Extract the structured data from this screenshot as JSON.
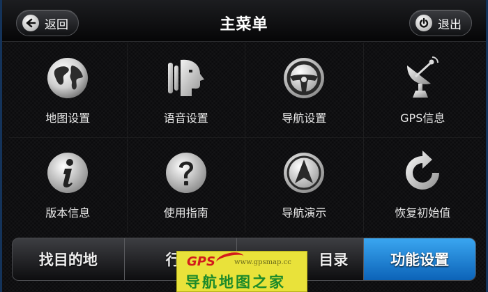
{
  "header": {
    "back_label": "返回",
    "title": "主菜单",
    "exit_label": "退出"
  },
  "menu": {
    "items": [
      {
        "label": "地图设置",
        "icon": "globe-icon"
      },
      {
        "label": "语音设置",
        "icon": "voice-head-icon"
      },
      {
        "label": "导航设置",
        "icon": "steering-wheel-icon"
      },
      {
        "label": "GPS信息",
        "icon": "satellite-dish-icon"
      },
      {
        "label": "版本信息",
        "icon": "info-icon"
      },
      {
        "label": "使用指南",
        "icon": "help-icon"
      },
      {
        "label": "导航演示",
        "icon": "navigation-arrow-icon"
      },
      {
        "label": "恢复初始值",
        "icon": "reset-icon"
      }
    ]
  },
  "tabs": [
    {
      "label": "找目的地"
    },
    {
      "label": "行程"
    },
    {
      "label": "目录"
    },
    {
      "label": "功能设置",
      "active": true
    }
  ],
  "watermark": {
    "brand": "GPS",
    "url": "www.gpsmap.cc",
    "text": "导航地图之家"
  },
  "colors": {
    "accent": "#1d86d8",
    "background": "#0b0b0d",
    "watermark_bg": "#e9e23a"
  }
}
